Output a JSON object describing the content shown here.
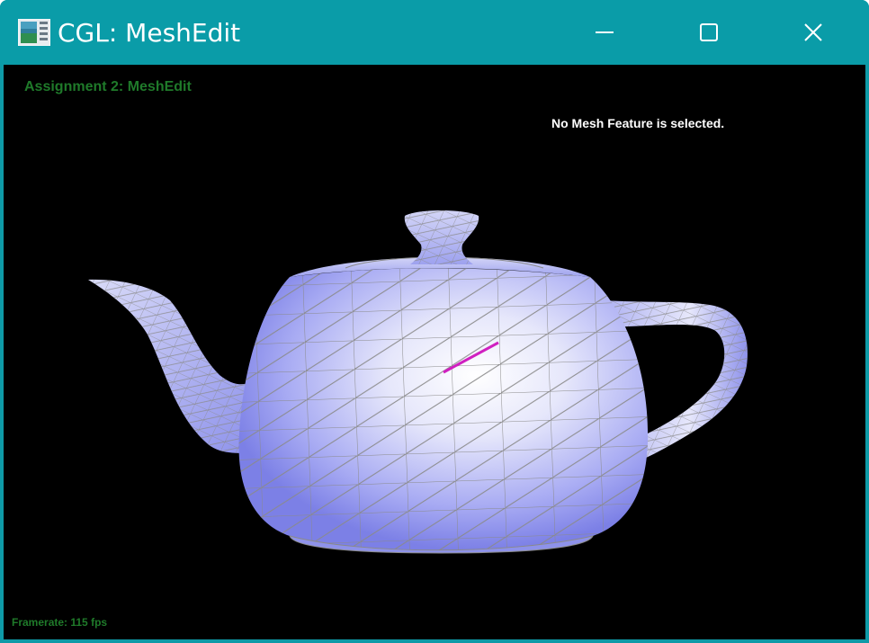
{
  "window": {
    "title": "CGL: MeshEdit",
    "titlebar_color": "#0a9ca8"
  },
  "icons": {
    "app": "app-window-icon",
    "minimize": "minimize-icon",
    "maximize": "maximize-icon",
    "close": "close-icon"
  },
  "hud": {
    "title": "Assignment 2: MeshEdit",
    "status": "No Mesh Feature is selected.",
    "framerate_label": "Framerate:",
    "framerate_value": "115 fps"
  },
  "scene": {
    "model": "teapot",
    "shading_color": "#9a9ef5",
    "wireframe_color": "#8a8a8a",
    "selected_edge_color": "#d020c0"
  }
}
